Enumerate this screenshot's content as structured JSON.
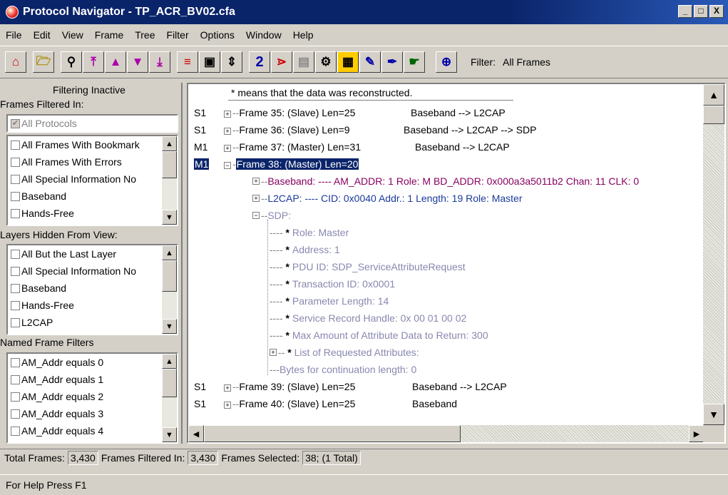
{
  "window": {
    "title": "Protocol Navigator - TP_ACR_BV02.cfa",
    "minimize": "_",
    "maximize": "□",
    "close": "X"
  },
  "menu": [
    "File",
    "Edit",
    "View",
    "Frame",
    "Tree",
    "Filter",
    "Options",
    "Window",
    "Help"
  ],
  "menu_underline": [
    "F",
    "E",
    "V",
    "r",
    "T",
    "i",
    "O",
    "W",
    "H"
  ],
  "toolbar": {
    "filter_label": "Filter:",
    "filter_value": "All Frames",
    "two": "2"
  },
  "left": {
    "filtering_status": "Filtering Inactive",
    "frames_filtered_in": "Frames Filtered In:",
    "all_protocols": "All Protocols",
    "filter_items": [
      "All Frames With Bookmark",
      "All Frames With Errors",
      "All Special Information No",
      "Baseband",
      "Hands-Free"
    ],
    "layers_hidden": "Layers Hidden From View:",
    "layer_items": [
      "All But the Last Layer",
      "All Special Information No",
      "Baseband",
      "Hands-Free",
      "L2CAP"
    ],
    "named_filters": "Named Frame Filters",
    "named_items": [
      "AM_Addr equals 0",
      "AM_Addr equals 1",
      "AM_Addr equals 2",
      "AM_Addr equals 3",
      "AM_Addr equals 4"
    ]
  },
  "tree": {
    "note": "* means that the data was reconstructed.",
    "frames": [
      {
        "side": "S1",
        "label": "Frame 35: (Slave) Len=25",
        "proto": "Baseband --> L2CAP"
      },
      {
        "side": "S1",
        "label": "Frame 36: (Slave) Len=9",
        "proto": "Baseband --> L2CAP --> SDP"
      },
      {
        "side": "M1",
        "label": "Frame 37: (Master) Len=31",
        "proto": "Baseband --> L2CAP"
      },
      {
        "side": "M1",
        "label": "Frame 38: (Master) Len=20",
        "proto": ""
      }
    ],
    "baseband": "Baseband: ---- AM_ADDR: 1 Role: M BD_ADDR: 0x000a3a5011b2 Chan: 11  CLK: 0",
    "l2cap": "L2CAP: ---- CID: 0x0040 Addr.: 1 Length: 19 Role: Master",
    "sdp": "SDP:",
    "sdp_fields": [
      "Role: Master",
      "Address: 1",
      "PDU ID: SDP_ServiceAttributeRequest",
      "Transaction ID: 0x0001",
      "Parameter Length: 14",
      "Service Record Handle: 0x 00 01 00 02",
      "Max Amount of Attribute Data to Return: 300",
      "List of Requested Attributes:"
    ],
    "continuation": "Bytes for continuation length: 0",
    "frames_after": [
      {
        "side": "S1",
        "label": "Frame 39: (Slave) Len=25",
        "proto": "Baseband --> L2CAP"
      },
      {
        "side": "S1",
        "label": "Frame 40: (Slave) Len=25",
        "proto": "Baseband"
      }
    ]
  },
  "status": {
    "total_label": "Total Frames:",
    "total": "3,430",
    "filtered_label": "Frames Filtered In:",
    "filtered": "3,430",
    "selected_label": "Frames Selected:",
    "selected": "38;  (1 Total)",
    "help": "For Help Press F1"
  }
}
